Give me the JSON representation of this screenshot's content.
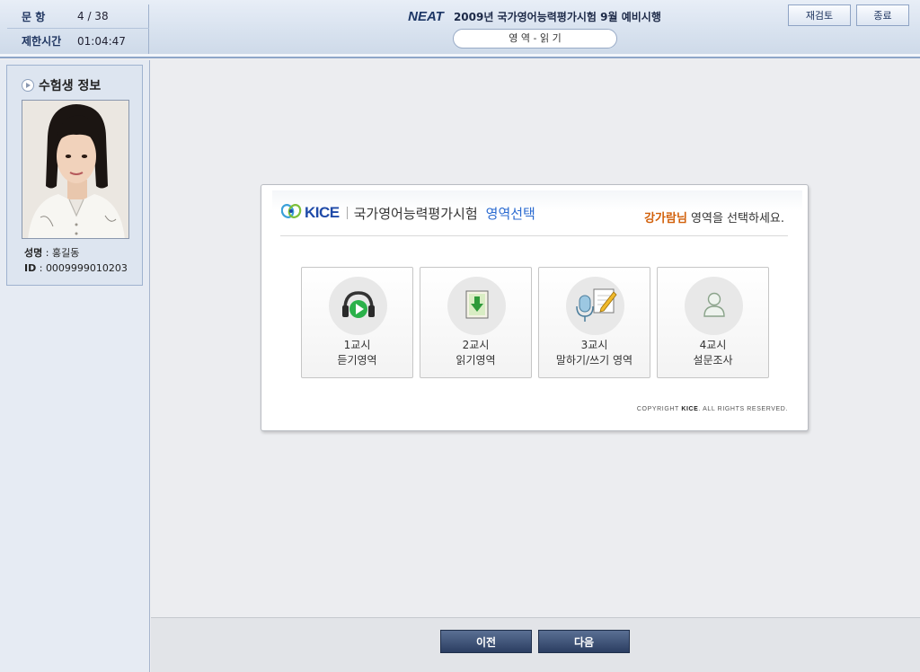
{
  "header": {
    "question_label": "문  항",
    "question_value": "4 / 38",
    "time_label": "제한시간",
    "time_value": "01:04:47",
    "brand": "NEAT",
    "exam_title": "2009년 국가영어능력평가시험 9월 예비시행",
    "section": "영 역 - 읽 기",
    "review_button": "재검토",
    "quit_button": "종료"
  },
  "sidebar": {
    "title": "수험생 정보",
    "name_label": "성명",
    "name_value": "홍길동",
    "id_label": "ID",
    "id_value": "0009999010203"
  },
  "panel": {
    "logo": "KICE",
    "title": "국가영어능력평가시험",
    "subtitle": "영역선택",
    "instruction_name": "강가람님",
    "instruction_text": "영역을 선택하세요.",
    "copyright_brand": "KICE",
    "copyright_pre": "COPYRIGHT",
    "copyright_post": ". ALL RIGHTS RESERVED.",
    "cards": [
      {
        "period": "1교시",
        "area": "듣기영역",
        "icon": "headphones-play-icon"
      },
      {
        "period": "2교시",
        "area": "읽기영역",
        "icon": "download-document-icon"
      },
      {
        "period": "3교시",
        "area": "말하기/쓰기 영역",
        "icon": "microphone-pen-icon"
      },
      {
        "period": "4교시",
        "area": "설문조사",
        "icon": "person-icon"
      }
    ]
  },
  "footer": {
    "prev_button": "이전",
    "next_button": "다음"
  },
  "colors": {
    "header_navy": "#1d3766",
    "accent_blue": "#2a6ad0",
    "user_orange": "#d2600a",
    "button_navy": "#2b3e62"
  }
}
